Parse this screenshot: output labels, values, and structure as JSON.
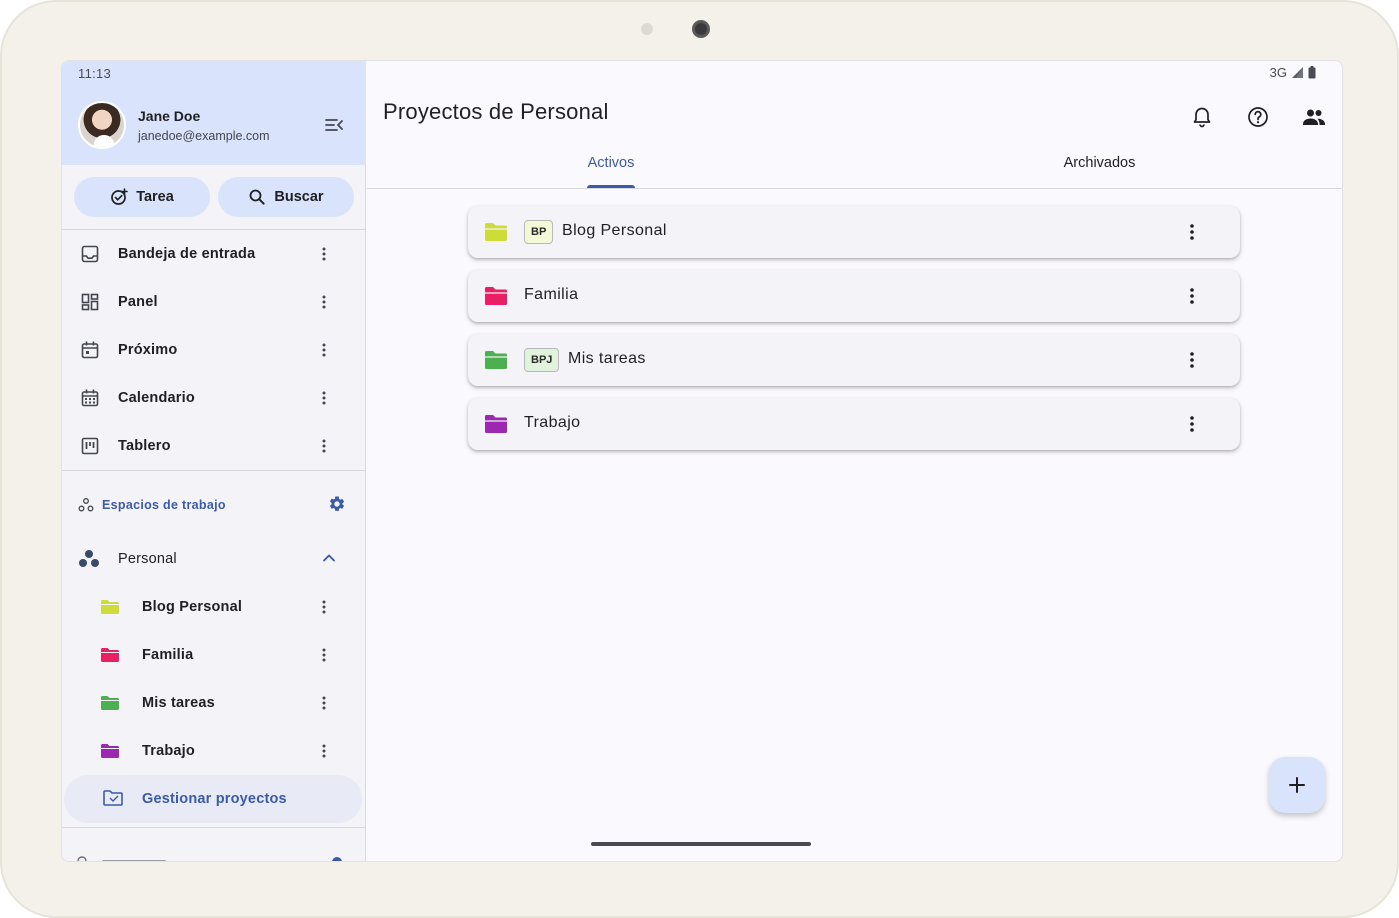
{
  "status": {
    "time": "11:13",
    "network": "3G"
  },
  "user": {
    "name": "Jane Doe",
    "email": "janedoe@example.com"
  },
  "actions": {
    "task_label": "Tarea",
    "search_label": "Buscar"
  },
  "nav": [
    {
      "label": "Bandeja de entrada",
      "icon": "inbox-icon"
    },
    {
      "label": "Panel",
      "icon": "dashboard-icon"
    },
    {
      "label": "Próximo",
      "icon": "calendar-today-icon"
    },
    {
      "label": "Calendario",
      "icon": "calendar-month-icon"
    },
    {
      "label": "Tablero",
      "icon": "board-icon"
    }
  ],
  "workspaces": {
    "header": "Espacios de trabajo",
    "current": "Personal",
    "projects": [
      {
        "label": "Blog Personal",
        "color": "#cddc39"
      },
      {
        "label": "Familia",
        "color": "#e91e63"
      },
      {
        "label": "Mis tareas",
        "color": "#4caf50"
      },
      {
        "label": "Trabajo",
        "color": "#9c27b0"
      }
    ],
    "manage_label": "Gestionar proyectos"
  },
  "main": {
    "title": "Proyectos de Personal",
    "tabs": [
      {
        "label": "Activos"
      },
      {
        "label": "Archivados"
      }
    ],
    "cards": [
      {
        "name": "Blog Personal",
        "badge": "BP",
        "color": "#cddc39",
        "badge_bg": "#f3f8d6"
      },
      {
        "name": "Familia",
        "badge": "",
        "color": "#e91e63",
        "badge_bg": ""
      },
      {
        "name": "Mis tareas",
        "badge": "BPJ",
        "color": "#4caf50",
        "badge_bg": "#e1f3dc"
      },
      {
        "name": "Trabajo",
        "badge": "",
        "color": "#9c27b0",
        "badge_bg": ""
      }
    ]
  },
  "colors": {
    "accent": "#3b5ba9",
    "primary_container": "#d9e3fb"
  }
}
